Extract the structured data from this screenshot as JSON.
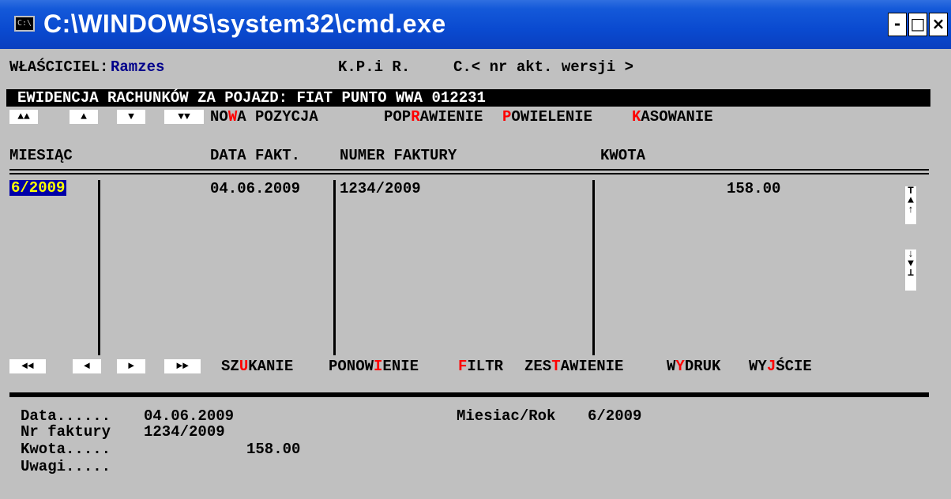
{
  "window": {
    "title": "C:\\WINDOWS\\system32\\cmd.exe",
    "icon_text": "C:\\",
    "minimize": "-",
    "maximize": "□",
    "close": "×"
  },
  "top": {
    "owner_label": "WŁAŚCICIEL:",
    "owner_value": "Ramzes",
    "program": "K.P.i R.",
    "version": "C.< nr akt. wersji >"
  },
  "header_bar": "EWIDENCJA RACHUNKÓW ZA POJAZD: FIAT PUNTO WWA 012231",
  "nav_top": [
    "▲▲",
    "▲",
    "▼",
    "▼▼"
  ],
  "menu_top": [
    {
      "pre": "NO",
      "hot": "W",
      "post": "A POZYCJA"
    },
    {
      "pre": "POP",
      "hot": "R",
      "post": "AWIENIE"
    },
    {
      "pre": "",
      "hot": "P",
      "post": "OWIELENIE"
    },
    {
      "pre": "",
      "hot": "K",
      "post": "ASOWANIE"
    }
  ],
  "columns": {
    "month": "MIESIĄC",
    "date": "DATA FAKT.",
    "number": "NUMER FAKTURY",
    "amount": "KWOTA"
  },
  "rows": [
    {
      "month": "6/2009",
      "date": "04.06.2009",
      "number": "1234/2009",
      "amount": "158.00"
    }
  ],
  "scroll_up": "T\n▲\n↑",
  "scroll_down": "↓\n▼\n⊥",
  "nav_bottom": [
    "◄◄",
    "◄",
    "►",
    "►►"
  ],
  "menu_bottom": [
    {
      "pre": "SZ",
      "hot": "U",
      "post": "KANIE"
    },
    {
      "pre": "PONOW",
      "hot": "I",
      "post": "ENIE"
    },
    {
      "pre": "",
      "hot": "F",
      "post": "ILTR"
    },
    {
      "pre": "ZES",
      "hot": "T",
      "post": "AWIENIE"
    },
    {
      "pre": "W",
      "hot": "Y",
      "post": "DRUK"
    },
    {
      "pre": "WY",
      "hot": "J",
      "post": "ŚCIE"
    }
  ],
  "details": {
    "date_label": "Data......",
    "date_value": "04.06.2009",
    "nr_label": "Nr faktury",
    "nr_value": "1234/2009",
    "amount_label": "Kwota.....",
    "amount_value": "158.00",
    "notes_label": "Uwagi.....",
    "period_label": "Miesiac/Rok",
    "period_value": "6/2009"
  }
}
